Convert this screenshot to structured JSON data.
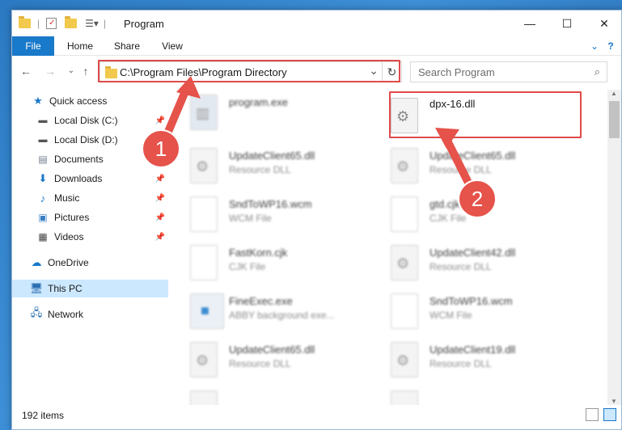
{
  "window": {
    "title": "Program",
    "controls": {
      "minimize": "—",
      "maximize": "☐",
      "close": "✕"
    }
  },
  "ribbon": {
    "tabs": [
      "File",
      "Home",
      "Share",
      "View"
    ],
    "help": "?"
  },
  "address_bar": {
    "path": "C:\\Program Files\\Program Directory",
    "refresh": "↻",
    "dropdown": "⌄"
  },
  "search": {
    "placeholder": "Search Program"
  },
  "sidebar": {
    "items": [
      {
        "label": "Quick access",
        "icon": "star-icon",
        "pinned": false
      },
      {
        "label": "Local Disk (C:)",
        "icon": "drive-icon",
        "pinned": true
      },
      {
        "label": "Local Disk (D:)",
        "icon": "drive-icon",
        "pinned": true
      },
      {
        "label": "Documents",
        "icon": "documents-icon",
        "pinned": true
      },
      {
        "label": "Downloads",
        "icon": "download-icon",
        "pinned": true
      },
      {
        "label": "Music",
        "icon": "music-icon",
        "pinned": true
      },
      {
        "label": "Pictures",
        "icon": "pictures-icon",
        "pinned": true
      },
      {
        "label": "Videos",
        "icon": "videos-icon",
        "pinned": true
      },
      {
        "label": "OneDrive",
        "icon": "cloud-icon",
        "pinned": false
      },
      {
        "label": "This PC",
        "icon": "computer-icon",
        "pinned": false
      },
      {
        "label": "Network",
        "icon": "network-icon",
        "pinned": false
      }
    ]
  },
  "files": [
    {
      "name": "program.exe",
      "type": ""
    },
    {
      "name": "dpx-16.dll",
      "type": ""
    },
    {
      "name": "UpdateClient65.dll",
      "type": "Resource DLL"
    },
    {
      "name": "UpdateClient65.dll",
      "type": "Resource DLL"
    },
    {
      "name": "SndToWP16.wcm",
      "type": "WCM File"
    },
    {
      "name": "gtd.cjk",
      "type": "CJK File"
    },
    {
      "name": "FastKorn.cjk",
      "type": "CJK File"
    },
    {
      "name": "UpdateClient42.dll",
      "type": "Resource DLL"
    },
    {
      "name": "FineExec.exe",
      "type": "ABBY background exe..."
    },
    {
      "name": "SndToWP16.wcm",
      "type": "WCM File"
    },
    {
      "name": "UpdateClient65.dll",
      "type": "Resource DLL"
    },
    {
      "name": "UpdateClient19.dll",
      "type": "Resource DLL"
    }
  ],
  "annotations": {
    "step1": "1",
    "step2": "2"
  },
  "status": {
    "count": "192 items"
  },
  "colors": {
    "accent": "#1979ca",
    "highlight": "#e04a4a",
    "selection": "#cce8ff"
  }
}
